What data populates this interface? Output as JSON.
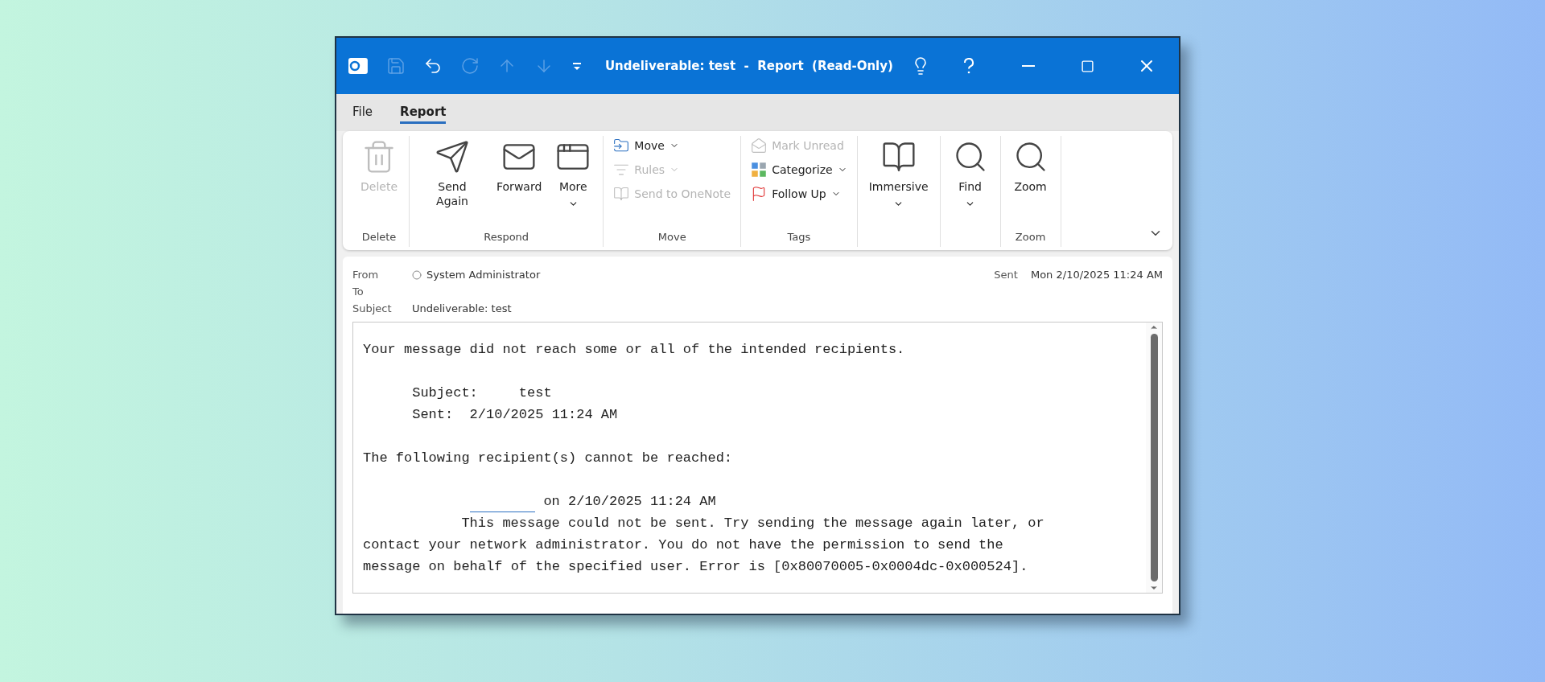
{
  "title_bar": {
    "title": "Undeliverable: test  -  Report  (Read-Only)"
  },
  "tabs": [
    {
      "label": "File",
      "selected": false
    },
    {
      "label": "Report",
      "selected": true
    }
  ],
  "ribbon": {
    "groups": [
      {
        "label": "Delete",
        "items": [
          {
            "kind": "large",
            "label": "Delete",
            "disabled": true,
            "dropdown": false
          }
        ]
      },
      {
        "label": "Respond",
        "items": [
          {
            "kind": "large",
            "label": "Send Again",
            "disabled": false,
            "dropdown": false
          },
          {
            "kind": "large",
            "label": "Forward",
            "disabled": false,
            "dropdown": false
          },
          {
            "kind": "large",
            "label": "More",
            "disabled": false,
            "dropdown": true
          }
        ]
      },
      {
        "label": "Move",
        "items": [
          {
            "kind": "small",
            "label": "Move",
            "disabled": false,
            "dropdown": true
          },
          {
            "kind": "small",
            "label": "Rules",
            "disabled": true,
            "dropdown": true
          },
          {
            "kind": "small",
            "label": "Send to OneNote",
            "disabled": true,
            "dropdown": false
          }
        ]
      },
      {
        "label": "Tags",
        "items": [
          {
            "kind": "small",
            "label": "Mark Unread",
            "disabled": true,
            "dropdown": false
          },
          {
            "kind": "small",
            "label": "Categorize",
            "disabled": false,
            "dropdown": true
          },
          {
            "kind": "small",
            "label": "Follow Up",
            "disabled": false,
            "dropdown": true
          }
        ]
      },
      {
        "items": [
          {
            "kind": "large",
            "label": "Immersive",
            "disabled": false,
            "dropdown": true
          }
        ]
      },
      {
        "items": [
          {
            "kind": "large",
            "label": "Find",
            "disabled": false,
            "dropdown": true
          }
        ]
      },
      {
        "label": "Zoom",
        "items": [
          {
            "kind": "large",
            "label": "Zoom",
            "disabled": false,
            "dropdown": false
          }
        ]
      }
    ]
  },
  "header": {
    "from_label": "From",
    "from": "System Administrator",
    "to_label": "To",
    "subject_label": "Subject",
    "subject": "Undeliverable: test",
    "sent_label": "Sent",
    "sent": "Mon 2/10/2025 11:24 AM"
  },
  "body": {
    "intro": "Your message did not reach some or all of the intended recipients.",
    "details": [
      {
        "label": "Subject:",
        "value": "test"
      },
      {
        "label": "Sent:",
        "value": "2/10/2025 11:24 AM"
      }
    ],
    "cannot_reach": "The following recipient(s) cannot be reached:",
    "recipient_date": "on 2/10/2025 11:24 AM",
    "error": "This message could not be sent. Try sending the message again later, or contact your network administrator. You do not have the permission to send the message on behalf of the specified user. Error is [0x80070005-0x0004dc-0x000524]."
  }
}
